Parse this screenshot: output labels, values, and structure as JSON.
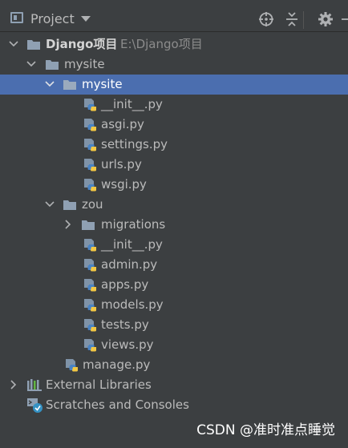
{
  "panel": {
    "title": "Project"
  },
  "tree": [
    {
      "label": "Django项目",
      "path": "E:\\Django项目",
      "type": "project-folder",
      "expanded": true
    },
    {
      "label": "mysite",
      "type": "folder",
      "expanded": true
    },
    {
      "label": "mysite",
      "type": "folder",
      "expanded": true,
      "selected": true
    },
    {
      "label": "__init__.py",
      "type": "py"
    },
    {
      "label": "asgi.py",
      "type": "py"
    },
    {
      "label": "settings.py",
      "type": "py"
    },
    {
      "label": "urls.py",
      "type": "py"
    },
    {
      "label": "wsgi.py",
      "type": "py"
    },
    {
      "label": "zou",
      "type": "folder",
      "expanded": true
    },
    {
      "label": "migrations",
      "type": "folder",
      "expanded": false
    },
    {
      "label": "__init__.py",
      "type": "py"
    },
    {
      "label": "admin.py",
      "type": "py"
    },
    {
      "label": "apps.py",
      "type": "py"
    },
    {
      "label": "models.py",
      "type": "py"
    },
    {
      "label": "tests.py",
      "type": "py"
    },
    {
      "label": "views.py",
      "type": "py"
    },
    {
      "label": "manage.py",
      "type": "py"
    },
    {
      "label": "External Libraries",
      "type": "libraries",
      "expanded": false
    },
    {
      "label": "Scratches and Consoles",
      "type": "scratches"
    }
  ],
  "watermark": "CSDN @准时准点睡觉",
  "colors": {
    "background": "#3c3f41",
    "selection": "#4b6eaf",
    "folder": "#8fa0b3",
    "text": "#bbbbbb"
  },
  "icons": {
    "toolbar": [
      "project-view-icon",
      "dropdown-caret-icon",
      "locate-icon",
      "collapse-all-icon",
      "settings-gear-icon",
      "hide-icon"
    ]
  }
}
